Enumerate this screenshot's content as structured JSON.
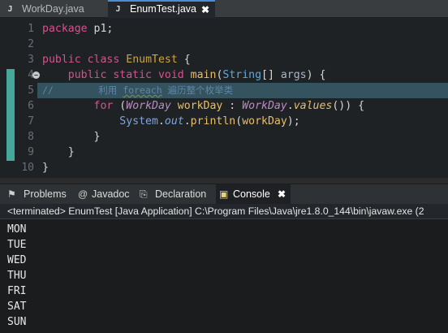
{
  "editor_tabs": [
    {
      "label": "WorkDay.java",
      "icon": "java-file-icon",
      "active": false
    },
    {
      "label": "EnumTest.java",
      "icon": "java-file-icon",
      "active": true,
      "close_glyph": "✖"
    }
  ],
  "editor": {
    "line_numbers": [
      "1",
      "2",
      "3",
      "4",
      "5",
      "6",
      "7",
      "8",
      "9",
      "10"
    ],
    "lines": {
      "l1": {
        "kw": "package",
        "rest": " p1;"
      },
      "l3": {
        "kw1": "public",
        "kw2": "class",
        "cls": "EnumTest",
        "rest": " {"
      },
      "l4": {
        "kw1": "public",
        "kw2": "static",
        "kw3": "void",
        "meth": "main",
        "paren": "(",
        "type": "String",
        "arr": "[] ",
        "param": "args",
        "rest": ") {"
      },
      "l5": {
        "comment_prefix": "//",
        "comment_pre": "利用 ",
        "comment_word": "foreach",
        "comment_post": " 遍历整个枚举类"
      },
      "l6": {
        "kw": "for",
        "p1": " (",
        "type": "WorkDay",
        "var": " workDay",
        "colon": " : ",
        "cls": "WorkDay",
        "dot": ".",
        "meth": "values",
        "rest": "()) {"
      },
      "l7": {
        "sys": "System",
        "dot1": ".",
        "out": "out",
        "dot2": ".",
        "meth": "println",
        "p1": "(",
        "arg": "workDay",
        "rest": ");"
      },
      "l8": {
        "text": "}"
      },
      "l9": {
        "text": "}"
      },
      "l10": {
        "text": "}"
      }
    }
  },
  "view_tabs": [
    {
      "label": "Problems",
      "icon": "problems-icon",
      "glyph": "⚑"
    },
    {
      "label": "Javadoc",
      "icon": "javadoc-icon",
      "glyph": "@"
    },
    {
      "label": "Declaration",
      "icon": "declaration-icon",
      "glyph": "⎘"
    },
    {
      "label": "Console",
      "icon": "console-icon",
      "glyph": "▣",
      "active": true,
      "close_glyph": "✖"
    }
  ],
  "console": {
    "status": "<terminated> EnumTest [Java Application] C:\\Program Files\\Java\\jre1.8.0_144\\bin\\javaw.exe (2",
    "output": [
      "MON",
      "TUE",
      "WED",
      "THU",
      "FRI",
      "SAT",
      "SUN"
    ]
  },
  "colors": {
    "accent": "#4a8cd6",
    "keyword": "#cc7832",
    "highlight_line": "#35535e",
    "gutter_mark": "#45a89a"
  }
}
